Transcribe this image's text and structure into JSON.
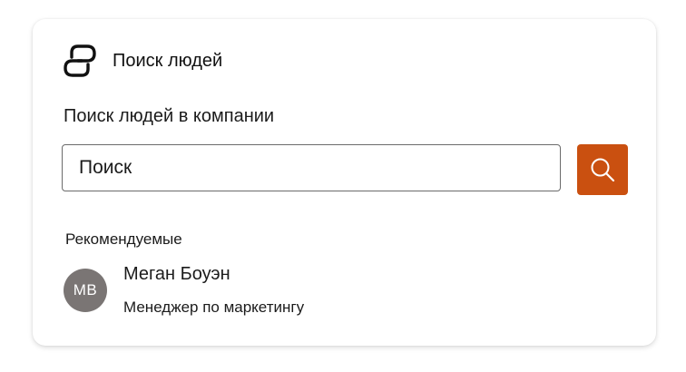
{
  "app": {
    "title": "Поиск людей",
    "icon": "people-search-app-icon"
  },
  "search": {
    "section_title": "Поиск людей в компании",
    "placeholder": "Поиск",
    "value": "",
    "button_icon": "search-icon",
    "button_color": "#ca5010"
  },
  "recommended": {
    "label": "Рекомендуемые",
    "people": [
      {
        "initials": "MB",
        "name": "Меган Боуэн",
        "role": "Менеджер по маркетингу",
        "avatar_color": "#7a7574"
      }
    ]
  }
}
